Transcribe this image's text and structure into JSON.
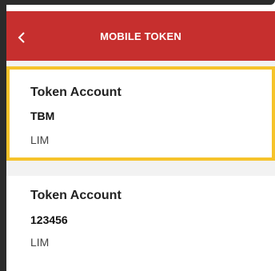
{
  "header": {
    "title": "MOBILE TOKEN",
    "back_icon": "chevron-left-icon",
    "background": "#c62f2e"
  },
  "accounts": [
    {
      "label": "Token Account",
      "value": "TBM",
      "sub": "LIM",
      "selected": true,
      "highlight_color": "#f6c32b"
    },
    {
      "label": "Token Account",
      "value": "123456",
      "sub": "LIM",
      "selected": false
    }
  ]
}
